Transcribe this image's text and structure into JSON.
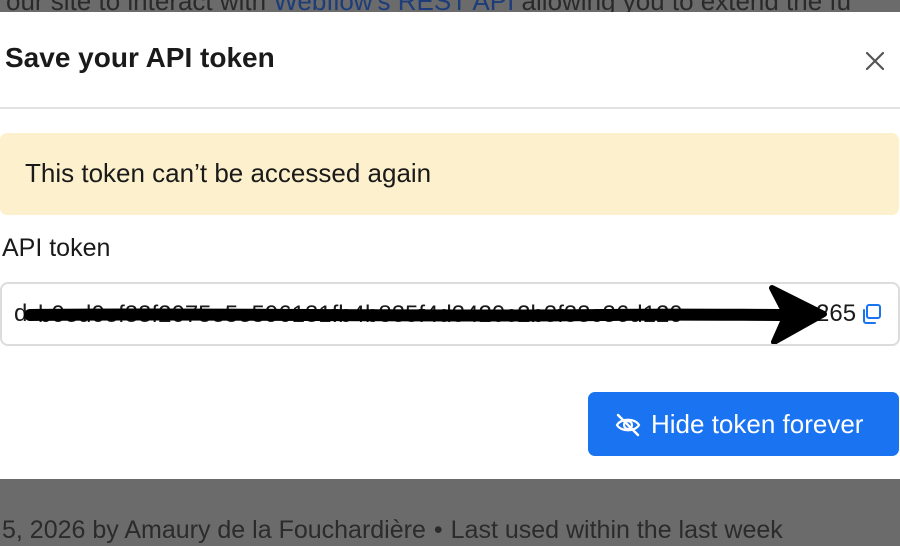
{
  "background": {
    "top_text_before": "our site to interact with ",
    "top_link": "Webflow's REST API",
    "top_text_after": " allowing you to extend the fu",
    "bottom_meta": "5, 2026 by Amaury de la Fouchardière",
    "bottom_separator": "•",
    "bottom_status": "Last used within the last week"
  },
  "modal": {
    "title": "Save your API token",
    "close_icon": "close-icon",
    "warning": {
      "text": "This token can’t be accessed again",
      "color": "#fdf1cd"
    },
    "token_field": {
      "label": "API token",
      "visible_prefix": "d",
      "obscured_value": "b0ed0ef33f2075e5e596131fb4b835f4d3420c2b3f33c36d120",
      "visible_suffix": "265",
      "copy_icon": "copy-icon",
      "redaction": "black hand-drawn line ending in an arrow"
    },
    "hide_button": {
      "label": "Hide token forever",
      "icon": "eye-off-icon",
      "color": "#1a73f0"
    }
  }
}
